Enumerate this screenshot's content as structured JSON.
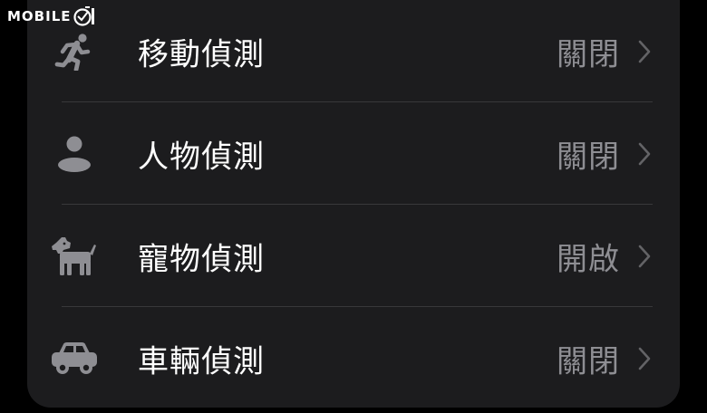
{
  "watermark": {
    "text": "MOBILE",
    "logo": "mobile01-logo"
  },
  "colors": {
    "background": "#000000",
    "panel": "#1c1c1e",
    "label": "#ffffff",
    "value": "#8e8e93",
    "icon": "#8e8e93",
    "divider": "#38383a"
  },
  "detection_list": {
    "items": [
      {
        "icon": "running-person-icon",
        "label": "移動偵測",
        "value": "關閉"
      },
      {
        "icon": "person-icon",
        "label": "人物偵測",
        "value": "關閉"
      },
      {
        "icon": "dog-icon",
        "label": "寵物偵測",
        "value": "開啟"
      },
      {
        "icon": "car-icon",
        "label": "車輛偵測",
        "value": "關閉"
      }
    ]
  }
}
